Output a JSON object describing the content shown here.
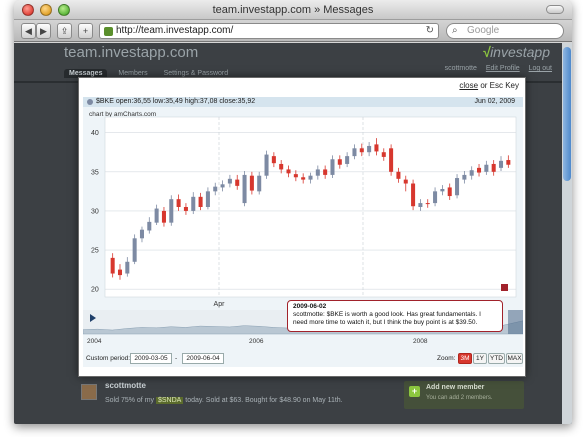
{
  "browser": {
    "window_title": "team.investapp.com » Messages",
    "url": "http://team.investapp.com/",
    "search_placeholder": "Google",
    "back_label": "◀",
    "forward_label": "▶",
    "share_label": "⇪",
    "add_label": "+"
  },
  "site": {
    "brand": "team.investapp.com",
    "logo_v": "√",
    "logo_text": "investapp",
    "user_links": [
      "scottmotte",
      "Edit Profile",
      "Log out"
    ],
    "nav_tabs": [
      "Messages",
      "Members",
      "Settings & Password"
    ]
  },
  "modal": {
    "close_link": "close",
    "close_suffix": " or Esc Key"
  },
  "chart_data": {
    "type": "candlestick",
    "title": "",
    "credit": "chart by amCharts.com",
    "legend": {
      "symbol": "$BKE",
      "text": "$BKE open:36,55 low:35,49 high:37,08 close:35,92",
      "date": "Jun 02, 2009"
    },
    "y_ticks": [
      20,
      25,
      30,
      35,
      40
    ],
    "ylim": [
      19,
      42
    ],
    "x_tick_label": "Apr",
    "up_color": "#7d8aa3",
    "down_color": "#d7372e",
    "candles": [
      {
        "o": 24.0,
        "c": 22.0,
        "h": 24.6,
        "l": 21.5
      },
      {
        "o": 22.5,
        "c": 21.8,
        "h": 23.2,
        "l": 21.2
      },
      {
        "o": 22.0,
        "c": 23.5,
        "h": 24.1,
        "l": 21.6
      },
      {
        "o": 23.5,
        "c": 26.5,
        "h": 27.0,
        "l": 23.2
      },
      {
        "o": 26.5,
        "c": 27.6,
        "h": 28.0,
        "l": 26.0
      },
      {
        "o": 27.5,
        "c": 28.6,
        "h": 29.2,
        "l": 27.1
      },
      {
        "o": 28.5,
        "c": 30.3,
        "h": 30.8,
        "l": 28.2
      },
      {
        "o": 30.0,
        "c": 28.5,
        "h": 30.5,
        "l": 28.0
      },
      {
        "o": 28.5,
        "c": 31.5,
        "h": 32.0,
        "l": 28.1
      },
      {
        "o": 31.5,
        "c": 30.5,
        "h": 32.1,
        "l": 30.0
      },
      {
        "o": 30.5,
        "c": 30.0,
        "h": 31.0,
        "l": 29.5
      },
      {
        "o": 30.0,
        "c": 31.8,
        "h": 32.4,
        "l": 29.6
      },
      {
        "o": 31.8,
        "c": 30.5,
        "h": 32.3,
        "l": 30.1
      },
      {
        "o": 30.5,
        "c": 32.5,
        "h": 33.0,
        "l": 30.2
      },
      {
        "o": 32.5,
        "c": 33.1,
        "h": 33.6,
        "l": 32.0
      },
      {
        "o": 33.0,
        "c": 33.4,
        "h": 33.9,
        "l": 32.5
      },
      {
        "o": 33.5,
        "c": 34.1,
        "h": 34.6,
        "l": 33.0
      },
      {
        "o": 34.0,
        "c": 33.2,
        "h": 34.6,
        "l": 32.7
      },
      {
        "o": 31.0,
        "c": 34.6,
        "h": 35.1,
        "l": 30.6
      },
      {
        "o": 34.5,
        "c": 32.6,
        "h": 35.0,
        "l": 32.1
      },
      {
        "o": 32.5,
        "c": 34.5,
        "h": 35.0,
        "l": 32.1
      },
      {
        "o": 34.5,
        "c": 37.2,
        "h": 37.7,
        "l": 34.1
      },
      {
        "o": 37.0,
        "c": 36.1,
        "h": 37.5,
        "l": 35.6
      },
      {
        "o": 36.0,
        "c": 35.3,
        "h": 36.5,
        "l": 34.8
      },
      {
        "o": 35.3,
        "c": 34.8,
        "h": 35.8,
        "l": 34.3
      },
      {
        "o": 34.7,
        "c": 34.3,
        "h": 35.2,
        "l": 33.8
      },
      {
        "o": 34.3,
        "c": 34.0,
        "h": 34.8,
        "l": 33.5
      },
      {
        "o": 34.0,
        "c": 34.5,
        "h": 34.9,
        "l": 33.5
      },
      {
        "o": 34.5,
        "c": 35.3,
        "h": 35.8,
        "l": 34.0
      },
      {
        "o": 35.3,
        "c": 34.6,
        "h": 35.8,
        "l": 34.1
      },
      {
        "o": 34.6,
        "c": 36.6,
        "h": 37.1,
        "l": 34.2
      },
      {
        "o": 36.6,
        "c": 35.9,
        "h": 37.1,
        "l": 35.4
      },
      {
        "o": 36.0,
        "c": 37.0,
        "h": 37.5,
        "l": 35.6
      },
      {
        "o": 37.0,
        "c": 38.0,
        "h": 38.5,
        "l": 36.6
      },
      {
        "o": 38.0,
        "c": 37.5,
        "h": 38.6,
        "l": 37.0
      },
      {
        "o": 37.5,
        "c": 38.3,
        "h": 38.8,
        "l": 37.0
      },
      {
        "o": 38.5,
        "c": 37.6,
        "h": 39.3,
        "l": 37.1
      },
      {
        "o": 37.5,
        "c": 36.9,
        "h": 38.0,
        "l": 36.4
      },
      {
        "o": 38.0,
        "c": 35.0,
        "h": 38.5,
        "l": 34.5
      },
      {
        "o": 35.0,
        "c": 34.1,
        "h": 35.5,
        "l": 33.6
      },
      {
        "o": 34.0,
        "c": 33.5,
        "h": 34.5,
        "l": 32.5
      },
      {
        "o": 33.5,
        "c": 30.6,
        "h": 34.0,
        "l": 30.1
      },
      {
        "o": 30.5,
        "c": 31.0,
        "h": 31.5,
        "l": 30.0
      },
      {
        "o": 31.0,
        "c": 30.9,
        "h": 31.5,
        "l": 30.4
      },
      {
        "o": 31.0,
        "c": 32.5,
        "h": 33.0,
        "l": 30.6
      },
      {
        "o": 32.5,
        "c": 32.8,
        "h": 33.3,
        "l": 32.0
      },
      {
        "o": 33.0,
        "c": 31.9,
        "h": 33.5,
        "l": 31.4
      },
      {
        "o": 32.0,
        "c": 34.2,
        "h": 34.7,
        "l": 31.6
      },
      {
        "o": 34.0,
        "c": 34.6,
        "h": 35.1,
        "l": 33.5
      },
      {
        "o": 34.5,
        "c": 35.2,
        "h": 35.7,
        "l": 34.0
      },
      {
        "o": 35.5,
        "c": 34.9,
        "h": 36.0,
        "l": 34.4
      },
      {
        "o": 35.0,
        "c": 35.9,
        "h": 36.4,
        "l": 34.6
      },
      {
        "o": 36.0,
        "c": 35.0,
        "h": 36.5,
        "l": 34.5
      },
      {
        "o": 35.5,
        "c": 36.4,
        "h": 37.0,
        "l": 35.1
      },
      {
        "o": 36.5,
        "c": 35.9,
        "h": 37.1,
        "l": 35.5
      }
    ],
    "navigator": {
      "year_labels": [
        "2004",
        "2006",
        "2008"
      ],
      "series": [
        0.2,
        0.22,
        0.18,
        0.25,
        0.3,
        0.28,
        0.33,
        0.3,
        0.36,
        0.34,
        0.32,
        0.38,
        0.35,
        0.3,
        0.27,
        0.24,
        0.2,
        0.22,
        0.26,
        0.3,
        0.28,
        0.32,
        0.36,
        0.42,
        0.4,
        0.35,
        0.28,
        0.22,
        0.3,
        0.45,
        0.6
      ]
    }
  },
  "annotation": {
    "date": "2009-06-02",
    "text": "scottmotte: $BKE is worth a good look. Has great fundamentals. I need more time to watch it, but I think the buy point is at $39.50."
  },
  "controls": {
    "custom_period_label": "Custom period:",
    "start_date": "2009-03-05",
    "separator": "-",
    "end_date": "2009-06-04",
    "zoom_label": "Zoom:",
    "zoom_options": [
      "3M",
      "1Y",
      "YTD",
      "MAX"
    ],
    "zoom_active": "3M"
  },
  "feed": {
    "author": "scottmotte",
    "text_before": "Sold 75% of my",
    "tag": "$SNDA",
    "text_after": "today. Sold at $63. Bought for $48.90 on May 11th."
  },
  "sidebar": {
    "title": "Add new member",
    "text": "You can add 2 members."
  }
}
